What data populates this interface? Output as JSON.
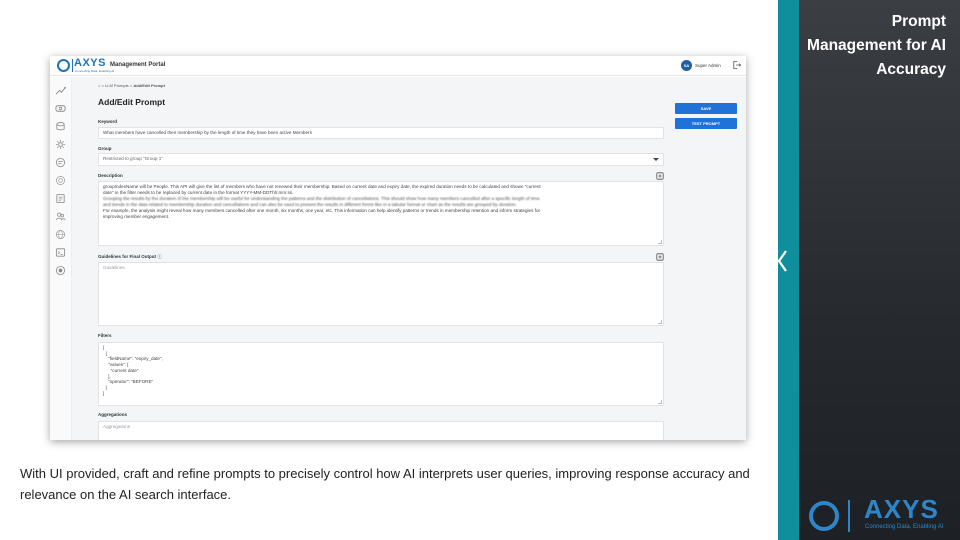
{
  "slide": {
    "title_lines": [
      "Prompt",
      "Management for AI",
      "Accuracy"
    ],
    "caption": "With UI provided, craft and refine prompts to precisely control how AI interprets user queries, improving response accuracy and relevance on the AI search interface.",
    "brand": {
      "name": "AXYS",
      "tagline": "Connecting Data, Enabling AI"
    },
    "panel_icon": "chevron-left-icon"
  },
  "app": {
    "logo": {
      "name": "AXYS",
      "tagline": "Connecting Data, Enabling AI"
    },
    "portal_title": "Management Portal",
    "user": {
      "initials": "SA",
      "name": "Super Admin"
    },
    "breadcrumb": {
      "home_icon": "home-icon",
      "items": [
        "LLM Prompts",
        "Add/Edit Prompt"
      ],
      "separator": ">"
    },
    "page_title": "Add/Edit Prompt",
    "buttons": {
      "save": "SAVE",
      "test": "TEST PROMPT"
    },
    "sidebar_icons": [
      "analytics-icon",
      "money-icon",
      "database-icon",
      "settings-icon",
      "chat-icon",
      "target-icon",
      "document-icon",
      "users-icon",
      "globe-icon",
      "terminal-icon",
      "support-icon"
    ],
    "form": {
      "keyword": {
        "label": "Keyword",
        "value": "What members have cancelled their membership by the length of time they have been active Members"
      },
      "group": {
        "label": "Group",
        "value": "Restricted to group \"Group 1\""
      },
      "description": {
        "label": "Description",
        "lines": [
          "groupIndexName will be People. This API will give the list of members who have not renewed their membership. Based on current date and expiry date, the expired duration needs to be calculated and shown \"current",
          "date\" in the filter needs to be replaced by current date in the format YYYY-MM-DDThh:mm:ss.",
          "Grouping the results by the duration of the membership will be useful for understanding the patterns and the distribution of cancellations. This should show how many members cancelled after a specific length of time.",
          "and trends in the data related to membership duration and cancellations and can also be used to present the results in different forms like in a tabular format or chart as the results are grouped by duration.",
          "For example, the analysis might reveal how many members cancelled after one month, six months, one year, etc. This information can help identify patterns or trends in membership retention and inform strategies for",
          "improving member engagement."
        ]
      },
      "guidelines": {
        "label": "Guidelines for Final Output",
        "placeholder": "Guidelines"
      },
      "filters": {
        "label": "Filters",
        "lines": [
          "[",
          "  {",
          "    \"fieldName\": \"expiry_date\",",
          "    \"values\": [",
          "      \"current date\"",
          "    ],",
          "    \"operator\": \"BEFORE\"",
          "  }",
          "]"
        ]
      },
      "aggregations": {
        "label": "Aggregations",
        "placeholder": "Aggregations"
      }
    }
  }
}
